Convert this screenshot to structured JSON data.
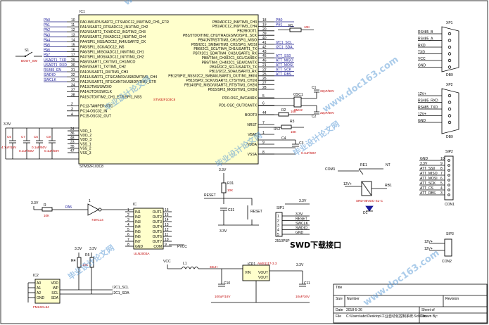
{
  "mcu": {
    "ref": "IC1",
    "name": "STM32F103C8",
    "footprint": "STM32F103C8",
    "left_pins": [
      {
        "num": "10",
        "name": "PA0-WKUP/USART2_CTS/ADC12_IN0/TIM2_CH1_ETR",
        "net": "PA0"
      },
      {
        "num": "11",
        "name": "PA1/USART2_RTS/ADC12_IN1/TIM2_CH2",
        "net": "PA1"
      },
      {
        "num": "12",
        "name": "PA2/USART2_TX/ADC12_IN2/TIM2_CH3",
        "net": "PA2"
      },
      {
        "num": "13",
        "name": "PA3/USART2_RX/ADC12_IN3/TIM2_CH4",
        "net": "PA3"
      },
      {
        "num": "14",
        "name": "PA4/SPI1_NSS/ADC12_IN4/USART2_CK",
        "net": "PA4"
      },
      {
        "num": "15",
        "name": "PA5/SPI1_SCK/ADC12_IN5",
        "net": "PA5"
      },
      {
        "num": "16",
        "name": "PA6/SPI1_MISO/ADC12_IN6/TIM3_CH1",
        "net": "PA6"
      },
      {
        "num": "17",
        "name": "PA7/SPI1_MOSI/ADC12_IN7/TIM3_CH2",
        "net": "PA7"
      },
      {
        "num": "29",
        "name": "PA8/USART1_CK/TIM1_CH1/MCO",
        "net": "USART1_TXD"
      },
      {
        "num": "30",
        "name": "PA9/USART1_TX/TIM1_CH2",
        "net": "USART1_RXD"
      },
      {
        "num": "31",
        "name": "PA10/USART1_RX/TIM1_CH3",
        "net": "RS485_EN"
      },
      {
        "num": "32",
        "name": "PA11/USART1_CTS/CANRX/USBDM/TIM1_CH4",
        "net": "SWDIO"
      },
      {
        "num": "33",
        "name": "PA12/USART1_RTS/CANTX/USBDP/TIM1_ETR",
        "net": "SWCLK"
      },
      {
        "num": "34",
        "name": "PA13/JTMS/SWDIO",
        "net": ""
      },
      {
        "num": "37",
        "name": "PA14/JTCK/SWCLK",
        "net": ""
      },
      {
        "num": "38",
        "name": "PA15/JTDI/TIM2_CH1_ETR/SPI1_NSS",
        "net": ""
      },
      {
        "num": "2",
        "name": "PC13-TAMPER-RTC",
        "net": ""
      },
      {
        "num": "3",
        "name": "PC14-OSC32_IN",
        "net": ""
      },
      {
        "num": "4",
        "name": "PC15-OSC32_OUT",
        "net": ""
      }
    ],
    "right_pins": [
      {
        "num": "18",
        "name": "PB0/ADC12_IN8/TIM3_CH3",
        "net": "PB0"
      },
      {
        "num": "19",
        "name": "PB1/ADC12_IN9/TIM3_CH4",
        "net": "PB1"
      },
      {
        "num": "20",
        "name": "PB2/BOOT1",
        "net": ""
      },
      {
        "num": "39",
        "name": "PB3/JTDO/TIM2_CH2/TRACESWO/SPI1_SCK",
        "net": ""
      },
      {
        "num": "40",
        "name": "PB4/JNTRST/TIM3_CH1/SPI1_MISO",
        "net": ""
      },
      {
        "num": "41",
        "name": "PB5/I2C1_SMBAI/TIM3_CH2/SPI1_MOSI",
        "net": "I2C1_SCL"
      },
      {
        "num": "42",
        "name": "PB6/I2C1_SCL/TIM4_CH1/USART1_TX",
        "net": "I2C1_SDA"
      },
      {
        "num": "43",
        "name": "PB7/I2C1_SDA/TIM4_CH2/USART1_RX",
        "net": ""
      },
      {
        "num": "45",
        "name": "PB8/TIM4_CH3/I2C1_SCL/CANRX",
        "net": "ATT_SS0"
      },
      {
        "num": "46",
        "name": "PB9/TIM4_CH4/I2C1_SDA/CANTX",
        "net": "ATT_MISO"
      },
      {
        "num": "21",
        "name": "PB10/I2C2_SCL/USART3_TX",
        "net": "ATT_MOSI"
      },
      {
        "num": "22",
        "name": "PB11/I2C2_SDA/USART3_RX",
        "net": "ATT_SCK"
      },
      {
        "num": "25",
        "name": "PB12/SPI2_NSS/I2C2_SMBAI/USART3_CK/TIM1_BKIN",
        "net": "ATT_RBS"
      },
      {
        "num": "26",
        "name": "PB13/SPI2_SCK/USART3_CTS/TIM1_CH1N",
        "net": ""
      },
      {
        "num": "27",
        "name": "PB14/SPI2_MISO/USART3_RTS/TIM1_CH2N",
        "net": ""
      },
      {
        "num": "28",
        "name": "PB15/SPI2_MOSI/TIM1_CH3N",
        "net": ""
      },
      {
        "num": "5",
        "name": "PD0-OSC_IN/CANRX",
        "net": ""
      },
      {
        "num": "6",
        "name": "PD1-OSC_OUT/CANTX",
        "net": ""
      },
      {
        "num": "44",
        "name": "BOOT0",
        "net": ""
      },
      {
        "num": "7",
        "name": "NRST",
        "net": ""
      },
      {
        "num": "1",
        "name": "VBAT",
        "net": ""
      },
      {
        "num": "9",
        "name": "VDDA",
        "net": ""
      },
      {
        "num": "8",
        "name": "VSSA",
        "net": ""
      }
    ],
    "power_pins": [
      {
        "num": "24",
        "name": "VDD_1"
      },
      {
        "num": "36",
        "name": "VDD_2"
      },
      {
        "num": "48",
        "name": "VDD_3"
      },
      {
        "num": "23",
        "name": "VSS_1"
      },
      {
        "num": "35",
        "name": "VSS_2"
      },
      {
        "num": "47",
        "name": "VSS_3"
      }
    ]
  },
  "passives": {
    "r1": {
      "ref": "R1",
      "value": "10K"
    },
    "r2": {
      "ref": "R2",
      "value": "10K"
    },
    "r3": {
      "ref": "R3",
      "value": "10K"
    },
    "r4": {
      "ref": "R4",
      "value": "10K"
    },
    "r5": {
      "ref": "R5",
      "value": "10K"
    },
    "r": {
      "ref": "R",
      "value": "10K"
    },
    "rs": {
      "ref": "RST",
      "value": ""
    },
    "osc1": {
      "ref": "OSC1",
      "value": "8MHz"
    },
    "c1": {
      "ref": "C1",
      "value": "22pF/50V"
    },
    "c2": {
      "ref": "C2",
      "value": "22pF/50V"
    },
    "c3": {
      "ref": "C3",
      "value": "0.1uF/50V"
    },
    "c4": {
      "ref": "C4",
      "value": "0.1uF/50V"
    },
    "c5": {
      "ref": "C5",
      "value": "0.1uF/50V"
    },
    "c6": {
      "ref": "C6",
      "value": "4.7uF/16V"
    },
    "c7": {
      "ref": "C7",
      "value": "0.1uF/50V"
    },
    "c9": {
      "ref": "C9",
      "value": "0.1uF/50V"
    },
    "c10": {
      "ref": "C10",
      "value": "100uF/16V"
    },
    "c11": {
      "ref": "C11",
      "value": "10uF/16V"
    },
    "c31": {
      "ref": "C31",
      "value": "0.1uF"
    },
    "l1": {
      "ref": "L1",
      "value": "33uH"
    },
    "r31": {
      "ref": "R31",
      "value": "10K"
    }
  },
  "supply": {
    "v33": "3.3V",
    "vcc": "VCC",
    "pvcc": "PVCC"
  },
  "reset": {
    "label": "RESET",
    "button": "RESET"
  },
  "s1": {
    "ref": "S1",
    "note": "BOOT_SW"
  },
  "xp1": {
    "ref": "XP1",
    "type": "DB9",
    "pins": [
      "RS485_B",
      "RS485_A",
      "RXD",
      "TXD",
      "VCC",
      "GND"
    ]
  },
  "xp2": {
    "ref": "XP2",
    "type": "DB9",
    "pins": [
      "12V+",
      "RS485_RXD",
      "RS485_TXD",
      "12V+",
      "GND"
    ]
  },
  "sip2": {
    "ref": "SIP2",
    "pins": [
      "GND",
      "3.3V",
      "ATT_SS0",
      "ATT_MISO",
      "ATT_MOSI",
      "ATT_SCK",
      "ATT_CS",
      "ATT_RBS"
    ],
    "label": "CON1"
  },
  "sip1": {
    "ref": "SIP1",
    "pins": [
      "3.3V",
      "RESET",
      "SWCLK",
      "SWDIO",
      "GND"
    ],
    "label": "2510P5P"
  },
  "sip3": {
    "ref": "SIP3",
    "pins": [
      "12V+",
      "12V+"
    ],
    "label": "CON2"
  },
  "relay": {
    "ref": "RE1",
    "com": "COM1",
    "nt": "NT",
    "coil": "12V+",
    "driver": "SRD-05VDC-SL-C",
    "diode": "D1",
    "rb": "RB1"
  },
  "inverter": {
    "ref": "1",
    "part": "74HC14",
    "in": "PA5"
  },
  "ic_ir": {
    "ref": "IC",
    "part": "ULN2003A",
    "left": [
      "IN1",
      "IN2",
      "IN3",
      "IN4",
      "IN5",
      "IN6",
      "IN7",
      "GND"
    ],
    "right": [
      "OUT1",
      "OUT2",
      "OUT3",
      "OUT4",
      "OUT5",
      "OUT6",
      "OUT7",
      "COM"
    ],
    "left_nums": [
      "1",
      "2",
      "3",
      "4",
      "5",
      "6",
      "7",
      "8"
    ],
    "right_nums": [
      "16",
      "15",
      "14",
      "13",
      "12",
      "11",
      "10",
      "9"
    ]
  },
  "ic2": {
    "ref": "IC2",
    "part": "FM24CL64",
    "left": [
      "A0",
      "A1",
      "A2",
      "GND"
    ],
    "right": [
      "VDD",
      "WP",
      "SCL",
      "SDA"
    ],
    "nets": [
      "I2C1_SCL",
      "I2C1_SDA"
    ]
  },
  "icp1": {
    "ref": "ICP1",
    "part": "AMS1117-3.3",
    "pins": [
      "VIN",
      "GND",
      "VOUT",
      "VOUT"
    ]
  },
  "swd_title": "SWD下载接口",
  "title_block": {
    "title": "Title",
    "size": "Size",
    "number": "Number",
    "revision": "Revision",
    "date_label": "Date",
    "date": "2018-5-26",
    "file_label": "File",
    "file": "C:\\Users\\abc\\Desktop\\工业自动化控制系统.SchDoc",
    "sheet": "Sheet of",
    "drawn": "Drawn By:"
  },
  "watermarks": [
    "毕业设计论文网",
    "www.doc163.com"
  ]
}
